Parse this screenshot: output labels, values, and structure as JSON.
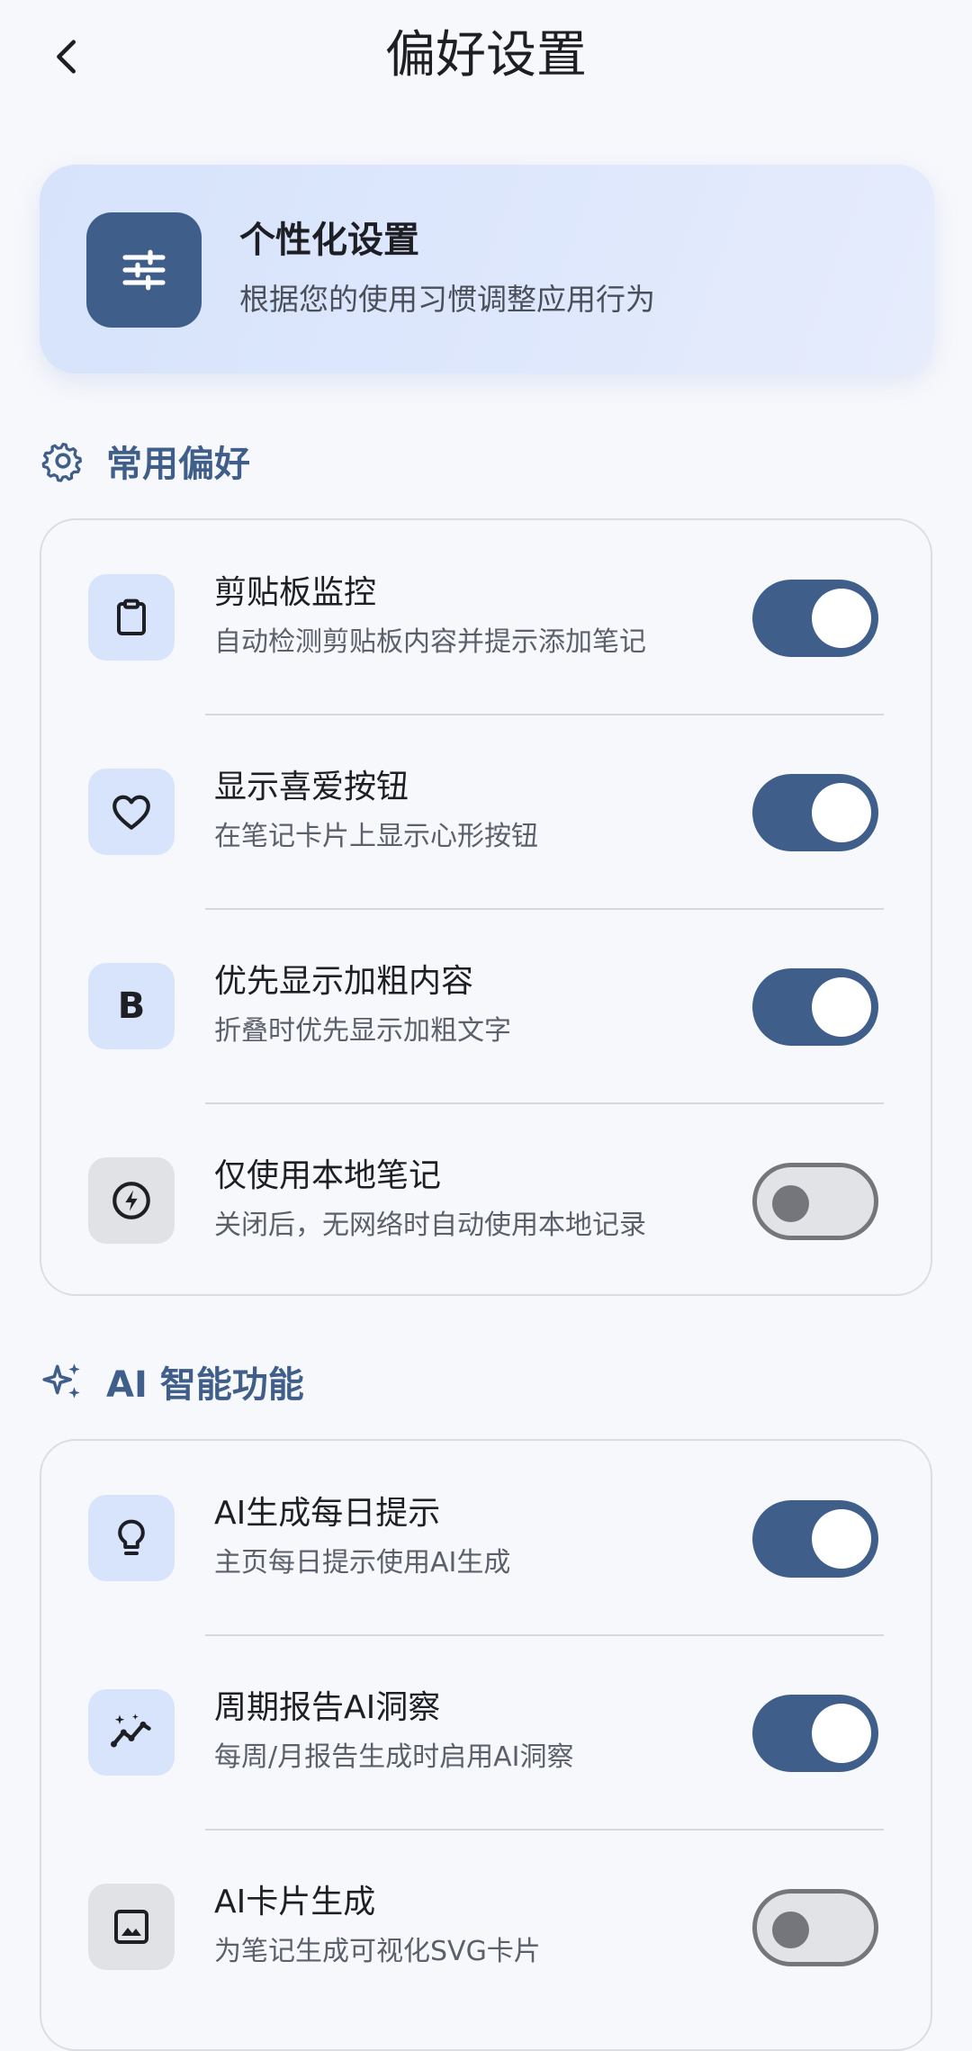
{
  "header": {
    "title": "偏好设置",
    "back_icon": "chevron-left-icon"
  },
  "hero": {
    "title": "个性化设置",
    "subtitle": "根据您的使用习惯调整应用行为",
    "icon": "sliders-icon"
  },
  "sections": [
    {
      "title": "常用偏好",
      "icon": "gear-icon",
      "items": [
        {
          "title": "剪贴板监控",
          "subtitle": "自动检测剪贴板内容并提示添加笔记",
          "icon": "clipboard-icon",
          "enabled": true
        },
        {
          "title": "显示喜爱按钮",
          "subtitle": "在笔记卡片上显示心形按钮",
          "icon": "heart-icon",
          "enabled": true
        },
        {
          "title": "优先显示加粗内容",
          "subtitle": "折叠时优先显示加粗文字",
          "icon": "bold-icon",
          "icon_text": "B",
          "enabled": true
        },
        {
          "title": "仅使用本地笔记",
          "subtitle": "关闭后，无网络时自动使用本地记录",
          "icon": "bolt-circle-icon",
          "enabled": false
        }
      ]
    },
    {
      "title": "AI 智能功能",
      "icon": "sparkles-icon",
      "items": [
        {
          "title": "AI生成每日提示",
          "subtitle": "主页每日提示使用AI生成",
          "icon": "lightbulb-icon",
          "enabled": true
        },
        {
          "title": "周期报告AI洞察",
          "subtitle": "每周/月报告生成时启用AI洞察",
          "icon": "insights-icon",
          "enabled": true
        },
        {
          "title": "AI卡片生成",
          "subtitle": "为笔记生成可视化SVG卡片",
          "icon": "image-icon",
          "enabled": false
        }
      ]
    }
  ],
  "colors": {
    "accent": "#3f5e8a",
    "background": "#f7f8fc",
    "icon_tile_on": "#d7e4fb",
    "icon_tile_off": "#e1e2e6"
  }
}
